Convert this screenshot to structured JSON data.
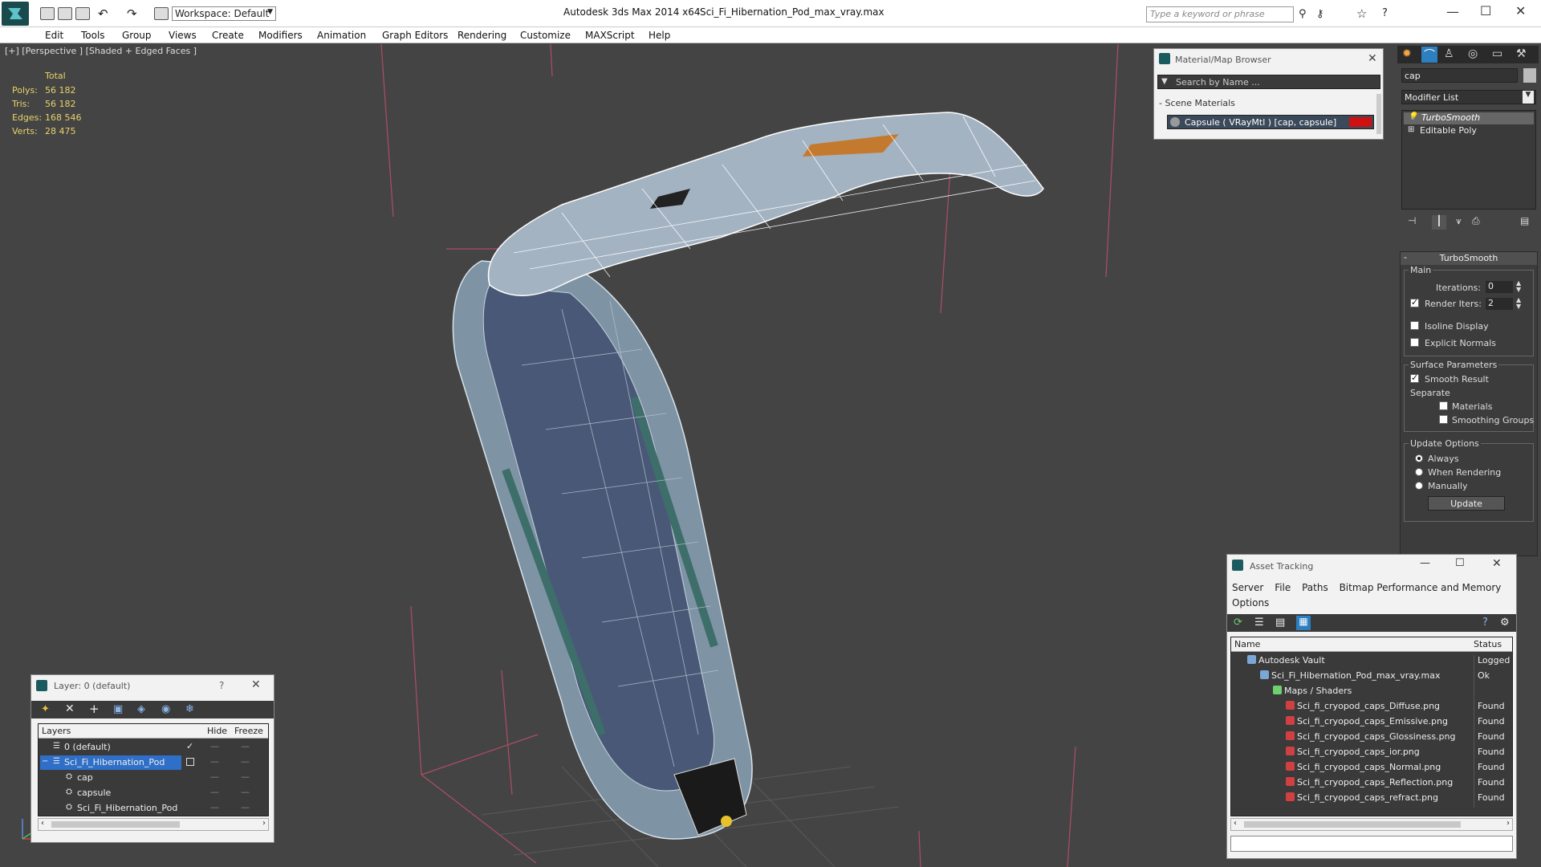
{
  "titlebar": {
    "workspace": "Workspace: Default",
    "app_title": "Autodesk 3ds Max  2014 x64",
    "file_title": "Sci_Fi_Hibernation_Pod_max_vray.max",
    "search_placeholder": "Type a keyword or phrase"
  },
  "menu": [
    "Edit",
    "Tools",
    "Group",
    "Views",
    "Create",
    "Modifiers",
    "Animation",
    "Graph Editors",
    "Rendering",
    "Customize",
    "MAXScript",
    "Help"
  ],
  "viewport": {
    "label": "[+] [Perspective ] [Shaded + Edged Faces ]",
    "stats_header": "Total",
    "stats": [
      {
        "k": "Polys:",
        "v": "56 182"
      },
      {
        "k": "Tris:",
        "v": "56 182"
      },
      {
        "k": "Edges:",
        "v": "168 546"
      },
      {
        "k": "Verts:",
        "v": "28 475"
      }
    ]
  },
  "material_browser": {
    "title": "Material/Map Browser",
    "search_placeholder": "Search by Name ...",
    "section": "- Scene Materials",
    "item": "Capsule  ( VRayMtl ) [cap, capsule]",
    "accent": "#d01010"
  },
  "command_panel": {
    "name_value": "cap",
    "modifier_list": "Modifier List",
    "stack": [
      "TurboSmooth",
      "Editable Poly"
    ],
    "rollout_title": "TurboSmooth",
    "main_label": "Main",
    "iterations_label": "Iterations:",
    "iterations_value": "0",
    "render_iters_label": "Render Iters:",
    "render_iters_value": "2",
    "isoline": "Isoline Display",
    "explicit": "Explicit Normals",
    "surface_label": "Surface Parameters",
    "smooth_result": "Smooth Result",
    "separate_label": "Separate",
    "materials": "Materials",
    "smoothing_groups": "Smoothing Groups",
    "update_label": "Update Options",
    "always": "Always",
    "when_rendering": "When Rendering",
    "manually": "Manually",
    "update_button": "Update"
  },
  "layers": {
    "title": "Layer: 0 (default)",
    "help": "?",
    "col_layers": "Layers",
    "col_hide": "Hide",
    "col_freeze": "Freeze",
    "rows": [
      {
        "name": "0 (default)",
        "indent": 1,
        "check": "✓"
      },
      {
        "name": "Sci_Fi_Hibernation_Pod",
        "indent": 1,
        "selected": true
      },
      {
        "name": "cap",
        "indent": 2
      },
      {
        "name": "capsule",
        "indent": 2
      },
      {
        "name": "Sci_Fi_Hibernation_Pod",
        "indent": 2
      }
    ]
  },
  "asset_tracking": {
    "title": "Asset Tracking",
    "menu": [
      "Server",
      "File",
      "Paths",
      "Bitmap Performance and Memory",
      "Options"
    ],
    "col_name": "Name",
    "col_status": "Status",
    "rows": [
      {
        "name": "Autodesk Vault",
        "status": "Logged C",
        "indent": 1
      },
      {
        "name": "Sci_Fi_Hibernation_Pod_max_vray.max",
        "status": "Ok",
        "indent": 2
      },
      {
        "name": "Maps / Shaders",
        "status": "",
        "indent": 3
      },
      {
        "name": "Sci_fi_cryopod_caps_Diffuse.png",
        "status": "Found",
        "indent": 4
      },
      {
        "name": "Sci_fi_cryopod_caps_Emissive.png",
        "status": "Found",
        "indent": 4
      },
      {
        "name": "Sci_fi_cryopod_caps_Glossiness.png",
        "status": "Found",
        "indent": 4
      },
      {
        "name": "Sci_fi_cryopod_caps_ior.png",
        "status": "Found",
        "indent": 4
      },
      {
        "name": "Sci_fi_cryopod_caps_Normal.png",
        "status": "Found",
        "indent": 4
      },
      {
        "name": "Sci_fi_cryopod_caps_Reflection.png",
        "status": "Found",
        "indent": 4
      },
      {
        "name": "Sci_fi_cryopod_caps_refract.png",
        "status": "Found",
        "indent": 4
      }
    ]
  }
}
